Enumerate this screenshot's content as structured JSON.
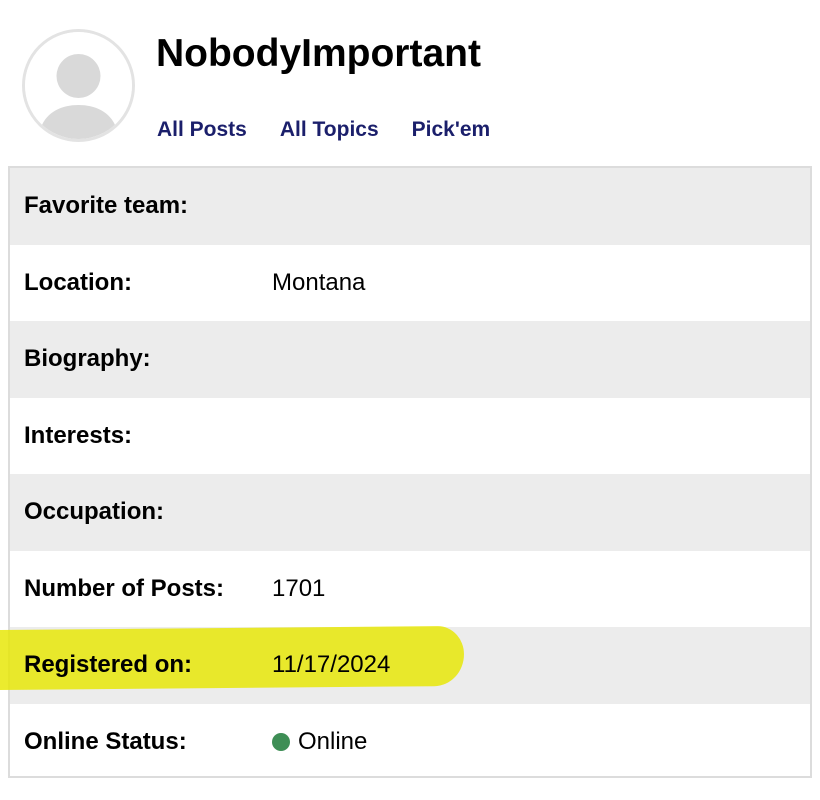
{
  "profile": {
    "username": "NobodyImportant"
  },
  "nav": {
    "links": [
      {
        "label": "All Posts"
      },
      {
        "label": "All Topics"
      },
      {
        "label": "Pick'em"
      }
    ]
  },
  "details": {
    "rows": [
      {
        "label": "Favorite team:",
        "value": ""
      },
      {
        "label": "Location:",
        "value": "Montana"
      },
      {
        "label": "Biography:",
        "value": ""
      },
      {
        "label": "Interests:",
        "value": ""
      },
      {
        "label": "Occupation:",
        "value": ""
      },
      {
        "label": "Number of Posts:",
        "value": "1701"
      },
      {
        "label": "Registered on:",
        "value": "11/17/2024"
      },
      {
        "label": "Online Status:",
        "value": "Online"
      }
    ]
  },
  "colors": {
    "link": "#1b1f6b",
    "row_shaded": "#ececec",
    "highlight": "#e6e600",
    "online_dot": "#3e8e55"
  },
  "icons": {
    "avatar": "default-user-avatar-icon",
    "status": "online-status-dot-icon"
  }
}
